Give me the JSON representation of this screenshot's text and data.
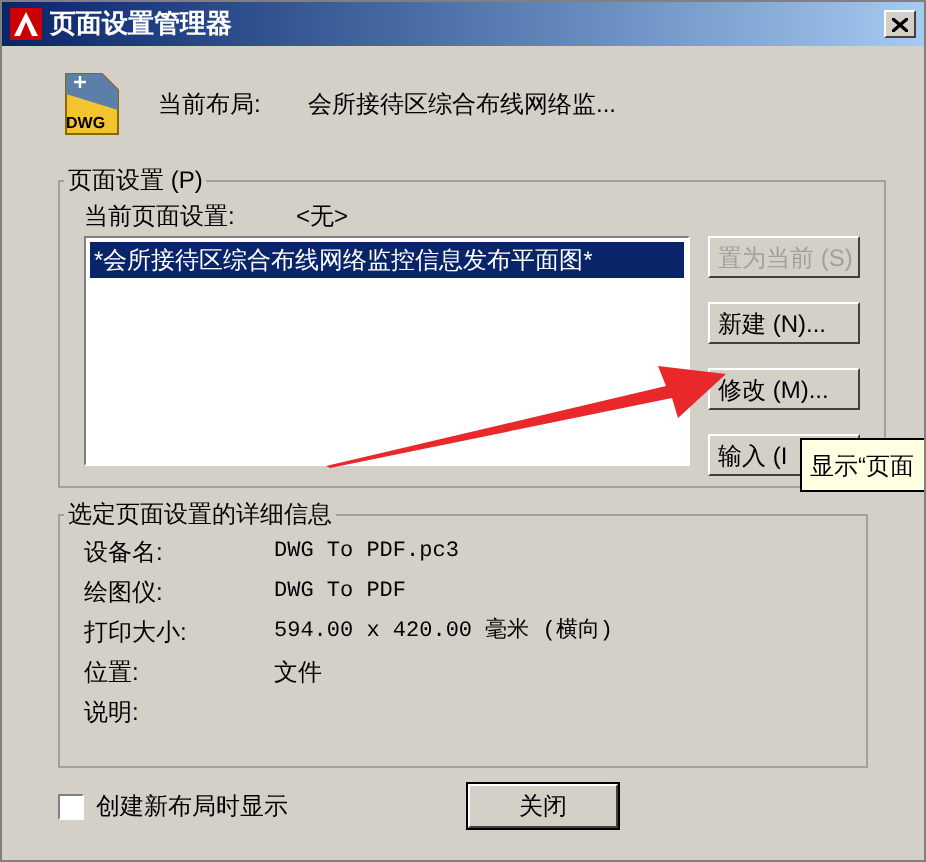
{
  "window": {
    "title": "页面设置管理器"
  },
  "current_layout": {
    "icon_text": "DWG",
    "label": "当前布局:",
    "value": "会所接待区综合布线网络监..."
  },
  "page_setups": {
    "title": "页面设置 (P)",
    "current_label": "当前页面设置:",
    "current_value": "<无>",
    "items": [
      {
        "label": "*会所接待区综合布线网络监控信息发布平面图*",
        "selected": true
      }
    ],
    "buttons": [
      {
        "label": "置为当前 (S)",
        "disabled": true
      },
      {
        "label": "新建 (N)...",
        "disabled": false
      },
      {
        "label": "修改 (M)...",
        "disabled": false
      },
      {
        "label": "输入 (I",
        "disabled": false
      }
    ]
  },
  "tooltip": "显示“页面",
  "details": {
    "title": "选定页面设置的详细信息",
    "rows": [
      {
        "label": "设备名:",
        "value": "DWG To PDF.pc3",
        "kind": "mono"
      },
      {
        "label": "绘图仪:",
        "value": "DWG To PDF",
        "kind": "mono"
      },
      {
        "label": "打印大小:",
        "value": "594.00 x 420.00 毫米 (横向)",
        "kind": "mono"
      },
      {
        "label": "位置:",
        "value": "文件",
        "kind": "plain"
      },
      {
        "label": "说明:"
      }
    ]
  },
  "show_on_new_layout": {
    "label": "创建新布局时显示",
    "checked": false
  },
  "close_button": "关闭"
}
